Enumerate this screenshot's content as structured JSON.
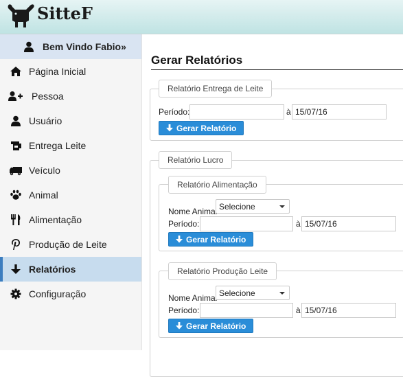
{
  "app": {
    "logo_text": "SitteF"
  },
  "sidebar": {
    "welcome": "Bem Vindo Fabio»",
    "items": [
      {
        "label": "Página Inicial",
        "icon": "home-icon"
      },
      {
        "label": "Pessoa",
        "icon": "user-plus-icon"
      },
      {
        "label": "Usuário",
        "icon": "user-icon"
      },
      {
        "label": "Entrega Leite",
        "icon": "milk-icon"
      },
      {
        "label": "Veículo",
        "icon": "truck-icon"
      },
      {
        "label": "Animal",
        "icon": "paw-icon"
      },
      {
        "label": "Alimentação",
        "icon": "cutlery-icon"
      },
      {
        "label": "Produção de Leite",
        "icon": "pinterest-icon"
      },
      {
        "label": "Relatórios",
        "icon": "arrow-down-icon",
        "active": true
      },
      {
        "label": "Configuração",
        "icon": "gear-icon"
      }
    ]
  },
  "main": {
    "title": "Gerar Relatórios",
    "entrega": {
      "legend": "Relatório Entrega de Leite",
      "periodo_label": "Período:",
      "from_value": "",
      "sep": "à",
      "to_value": "15/07/16",
      "button": "Gerar Relatório"
    },
    "lucro": {
      "legend": "Relatório Lucro",
      "alimentacao": {
        "legend": "Relatório Alimentação",
        "animal_label": "Nome Animal",
        "animal_select": "Selecione",
        "periodo_label": "Período:",
        "from_value": "",
        "sep": "à",
        "to_value": "15/07/16",
        "button": "Gerar Relatório"
      },
      "producao": {
        "legend": "Relatório Produção Leite",
        "animal_label": "Nome Animal",
        "animal_select": "Selecione",
        "periodo_label": "Período:",
        "from_value": "",
        "sep": "à",
        "to_value": "15/07/16",
        "button": "Gerar Relatório"
      }
    }
  },
  "colors": {
    "accent": "#2a8dd8",
    "active_item": "#c7dcee",
    "header_bg": "#bfe3e3"
  }
}
